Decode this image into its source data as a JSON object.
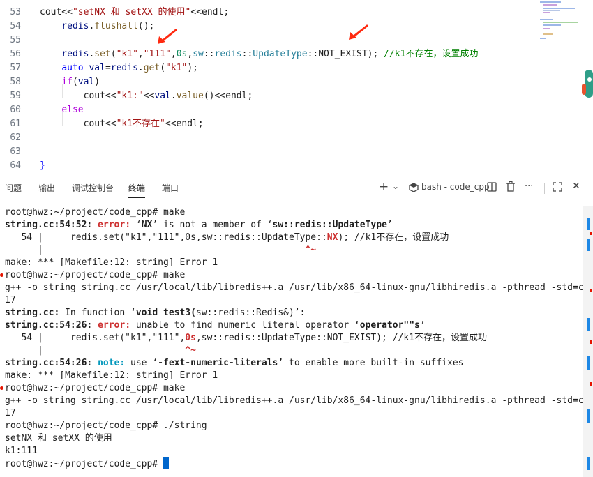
{
  "editor": {
    "line_numbers": [
      "53",
      "54",
      "55",
      "56",
      "57",
      "58",
      "59",
      "60",
      "61",
      "62",
      "63",
      "64"
    ],
    "lines": [
      [
        {
          "t": "cout<<",
          "c": ""
        },
        {
          "t": "\"setNX 和 setXX 的使用\"",
          "c": "str"
        },
        {
          "t": "<<endl;",
          "c": ""
        }
      ],
      [
        {
          "t": "    ",
          "c": ""
        },
        {
          "t": "redis",
          "c": "var"
        },
        {
          "t": ".",
          "c": ""
        },
        {
          "t": "flushall",
          "c": "fn"
        },
        {
          "t": "();",
          "c": ""
        }
      ],
      [],
      [
        {
          "t": "    ",
          "c": ""
        },
        {
          "t": "redis",
          "c": "var"
        },
        {
          "t": ".",
          "c": ""
        },
        {
          "t": "set",
          "c": "fn"
        },
        {
          "t": "(",
          "c": ""
        },
        {
          "t": "\"k1\"",
          "c": "str"
        },
        {
          "t": ",",
          "c": ""
        },
        {
          "t": "\"111\"",
          "c": "str"
        },
        {
          "t": ",",
          "c": ""
        },
        {
          "t": "0s",
          "c": "num"
        },
        {
          "t": ",",
          "c": ""
        },
        {
          "t": "sw",
          "c": "ns"
        },
        {
          "t": "::",
          "c": ""
        },
        {
          "t": "redis",
          "c": "ns"
        },
        {
          "t": "::",
          "c": ""
        },
        {
          "t": "UpdateType",
          "c": "ns"
        },
        {
          "t": "::NOT_EXIST); ",
          "c": ""
        },
        {
          "t": "//k1不存在，设置成功",
          "c": "cm"
        }
      ],
      [
        {
          "t": "    ",
          "c": ""
        },
        {
          "t": "auto",
          "c": "kw"
        },
        {
          "t": " ",
          "c": ""
        },
        {
          "t": "val",
          "c": "var"
        },
        {
          "t": "=",
          "c": ""
        },
        {
          "t": "redis",
          "c": "var"
        },
        {
          "t": ".",
          "c": ""
        },
        {
          "t": "get",
          "c": "fn"
        },
        {
          "t": "(",
          "c": ""
        },
        {
          "t": "\"k1\"",
          "c": "str"
        },
        {
          "t": ");",
          "c": ""
        }
      ],
      [
        {
          "t": "    ",
          "c": ""
        },
        {
          "t": "if",
          "c": "pp"
        },
        {
          "t": "(",
          "c": ""
        },
        {
          "t": "val",
          "c": "var"
        },
        {
          "t": ")",
          "c": ""
        }
      ],
      [
        {
          "t": "        cout<<",
          "c": ""
        },
        {
          "t": "\"k1:\"",
          "c": "str"
        },
        {
          "t": "<<",
          "c": ""
        },
        {
          "t": "val",
          "c": "var"
        },
        {
          "t": ".",
          "c": ""
        },
        {
          "t": "value",
          "c": "fn"
        },
        {
          "t": "()<<endl;",
          "c": ""
        }
      ],
      [
        {
          "t": "    ",
          "c": ""
        },
        {
          "t": "else",
          "c": "pp"
        }
      ],
      [
        {
          "t": "        cout<<",
          "c": ""
        },
        {
          "t": "\"k1不存在\"",
          "c": "str"
        },
        {
          "t": "<<endl;",
          "c": ""
        }
      ],
      [],
      [],
      [
        {
          "t": "}",
          "c": "ty"
        }
      ]
    ]
  },
  "panel": {
    "tabs": [
      "问题",
      "输出",
      "调试控制台",
      "终端",
      "端口"
    ],
    "active_tab": "终端",
    "add_label": "+",
    "dropdown_label": "⌄",
    "shell_label": "bash - code_cpp",
    "more_label": "···",
    "close_label": "✕"
  },
  "terminal": {
    "lines": [
      [
        {
          "t": "root@hwz:~/project/code_cpp# make",
          "c": ""
        }
      ],
      [
        {
          "t": "string.cc:54:52: ",
          "c": "b"
        },
        {
          "t": "error:",
          "c": "red"
        },
        {
          "t": " ‘",
          "c": ""
        },
        {
          "t": "NX",
          "c": "b"
        },
        {
          "t": "’ is not a member of ‘",
          "c": ""
        },
        {
          "t": "sw::redis::UpdateType",
          "c": "b"
        },
        {
          "t": "’",
          "c": ""
        }
      ],
      [
        {
          "t": "   54 |     redis.set(\"k1\",\"111\",0s,sw::redis::UpdateType::",
          "c": ""
        },
        {
          "t": "NX",
          "c": "red"
        },
        {
          "t": "); //k1不存在，设置成功",
          "c": ""
        }
      ],
      [
        {
          "t": "      |                                                ",
          "c": ""
        },
        {
          "t": "^~",
          "c": "red"
        }
      ],
      [
        {
          "t": "make: *** [Makefile:12: string] Error 1",
          "c": ""
        }
      ],
      [
        {
          "t": "root@hwz:~/project/code_cpp# make",
          "c": ""
        }
      ],
      [
        {
          "t": "g++ -o string string.cc /usr/local/lib/libredis++.a /usr/lib/x86_64-linux-gnu/libhiredis.a -pthread -std=c++",
          "c": ""
        }
      ],
      [
        {
          "t": "17",
          "c": ""
        }
      ],
      [
        {
          "t": "string.cc:",
          "c": "b"
        },
        {
          "t": " In function ‘",
          "c": ""
        },
        {
          "t": "void test3(",
          "c": "b"
        },
        {
          "t": "sw::redis::Redis&)’:",
          "c": ""
        }
      ],
      [
        {
          "t": "string.cc:54:26: ",
          "c": "b"
        },
        {
          "t": "error:",
          "c": "red"
        },
        {
          "t": " unable to find numeric literal operator ‘",
          "c": ""
        },
        {
          "t": "operator\"\"s",
          "c": "b"
        },
        {
          "t": "’",
          "c": ""
        }
      ],
      [
        {
          "t": "   54 |     redis.set(\"k1\",\"111\",",
          "c": ""
        },
        {
          "t": "0s",
          "c": "red"
        },
        {
          "t": ",sw::redis::UpdateType::NOT_EXIST); //k1不存在，设置成功",
          "c": ""
        }
      ],
      [
        {
          "t": "      |                          ",
          "c": ""
        },
        {
          "t": "^~",
          "c": "red"
        }
      ],
      [
        {
          "t": "string.cc:54:26: ",
          "c": "b"
        },
        {
          "t": "note:",
          "c": "cyan"
        },
        {
          "t": " use ‘",
          "c": ""
        },
        {
          "t": "-fext-numeric-literals",
          "c": "b"
        },
        {
          "t": "’ to enable more built-in suffixes",
          "c": ""
        }
      ],
      [
        {
          "t": "make: *** [Makefile:12: string] Error 1",
          "c": ""
        }
      ],
      [
        {
          "t": "root@hwz:~/project/code_cpp# make",
          "c": ""
        }
      ],
      [
        {
          "t": "g++ -o string string.cc /usr/local/lib/libredis++.a /usr/lib/x86_64-linux-gnu/libhiredis.a -pthread -std=c++",
          "c": ""
        }
      ],
      [
        {
          "t": "17",
          "c": ""
        }
      ],
      [
        {
          "t": "root@hwz:~/project/code_cpp# ./string",
          "c": ""
        }
      ],
      [
        {
          "t": "setNX 和 setXX 的使用",
          "c": ""
        }
      ],
      [
        {
          "t": "k1:111",
          "c": ""
        }
      ],
      [
        {
          "t": "root@hwz:~/project/code_cpp# ",
          "c": ""
        }
      ]
    ]
  }
}
